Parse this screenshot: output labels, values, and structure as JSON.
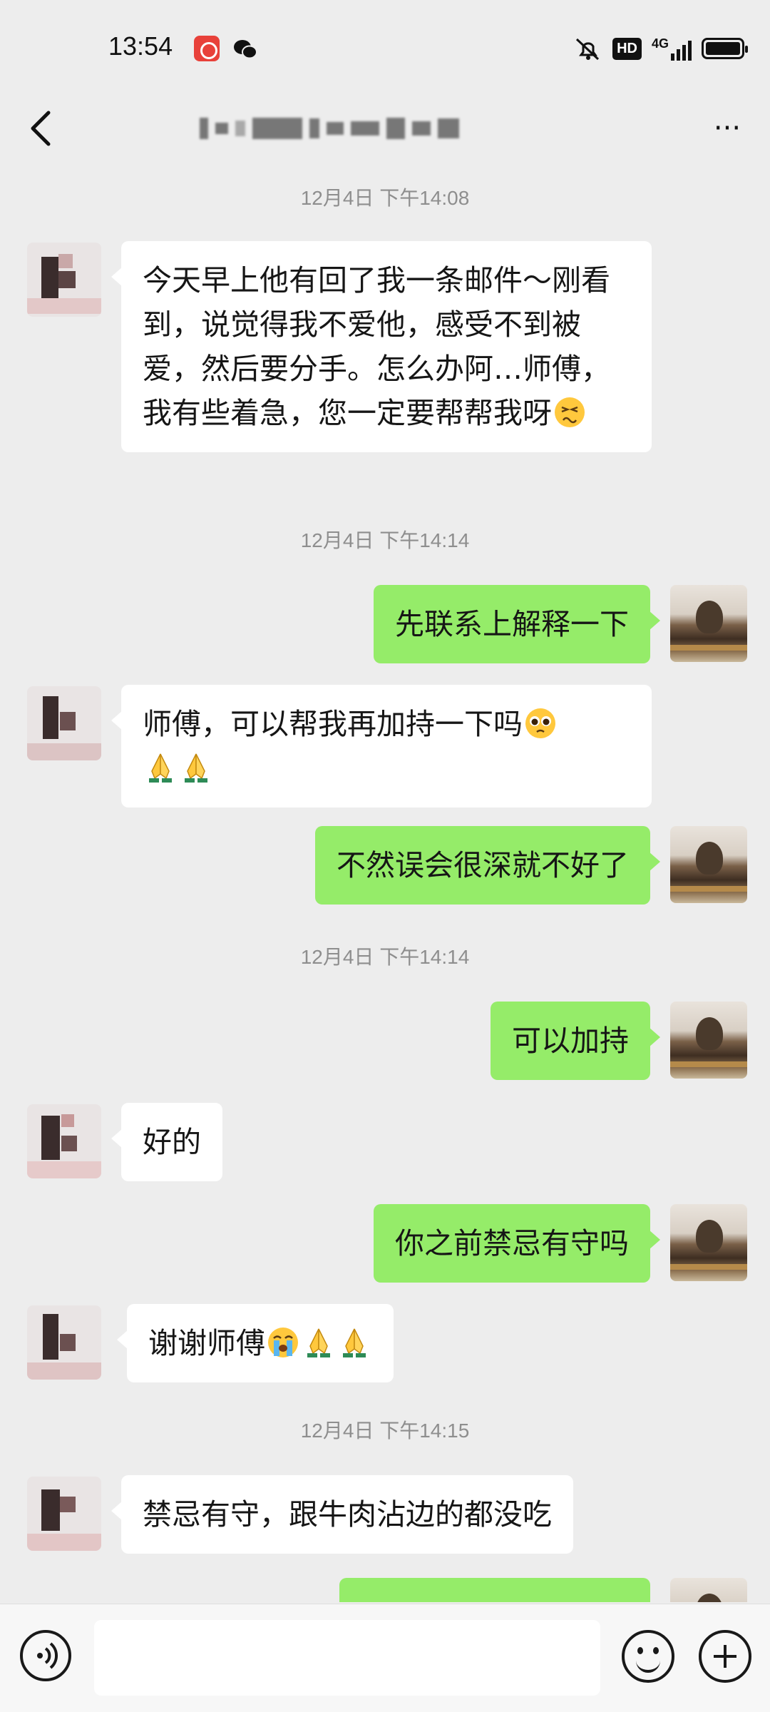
{
  "status_bar": {
    "time": "13:54",
    "hd_label": "HD",
    "network_label": "4G"
  },
  "nav": {
    "title_obscured": true,
    "more_label": "···"
  },
  "messages": [
    {
      "type": "timestamp",
      "text": "12月4日 下午14:08"
    },
    {
      "type": "incoming",
      "text": "今天早上他有回了我一条邮件～刚看到，说觉得我不爱他，感受不到被爱，然后要分手。怎么办阿…师傅，我有些着急，您一定要帮帮我呀",
      "emoji": [
        "persevering-face"
      ]
    },
    {
      "type": "timestamp",
      "text": "12月4日 下午14:14"
    },
    {
      "type": "outgoing",
      "text": "先联系上解释一下"
    },
    {
      "type": "incoming",
      "text": "师傅，可以帮我再加持一下吗",
      "emoji": [
        "pleading-face",
        "folded-hands",
        "folded-hands"
      ]
    },
    {
      "type": "outgoing",
      "text": "不然误会很深就不好了"
    },
    {
      "type": "timestamp",
      "text": "12月4日 下午14:14"
    },
    {
      "type": "outgoing",
      "text": "可以加持"
    },
    {
      "type": "incoming",
      "text": "好的"
    },
    {
      "type": "outgoing",
      "text": "你之前禁忌有守吗"
    },
    {
      "type": "incoming",
      "text": "谢谢师傅",
      "emoji": [
        "crying-face",
        "folded-hands",
        "folded-hands"
      ]
    },
    {
      "type": "timestamp",
      "text": "12月4日 下午14:15"
    },
    {
      "type": "incoming",
      "text": "禁忌有守，跟牛肉沾边的都没吃"
    },
    {
      "type": "outgoing",
      "text": ""
    }
  ],
  "input": {
    "placeholder": ""
  },
  "colors": {
    "background": "#ededed",
    "outgoing_bubble": "#95ec69",
    "incoming_bubble": "#ffffff",
    "timestamp_text": "#8e8e8e"
  }
}
